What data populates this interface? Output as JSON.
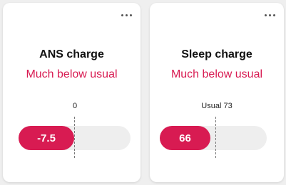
{
  "cards": [
    {
      "title": "ANS charge",
      "status": "Much below usual",
      "reference_label": "0",
      "value": "-7.5"
    },
    {
      "title": "Sleep charge",
      "status": "Much below usual",
      "reference_label": "Usual 73",
      "value": "66"
    }
  ],
  "colors": {
    "accent": "#d81b52",
    "track": "#eeeeee",
    "card": "#ffffff",
    "background": "#efefef"
  }
}
